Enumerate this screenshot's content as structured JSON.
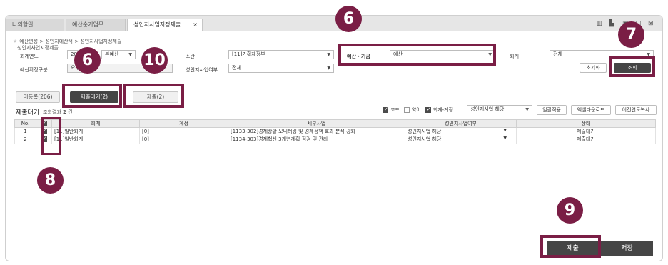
{
  "tabs": [
    {
      "label": "나의할일",
      "active": false
    },
    {
      "label": "예산순기업무",
      "active": false
    },
    {
      "label": "성인지사업지정제출",
      "active": true
    }
  ],
  "tab_close": "×",
  "breadcrumb": "예산편성 > 성인지예산서 > 성인지사업지정제출",
  "page_subtitle": "성인지사업지정제출",
  "filters": {
    "fiscal_year_label": "회계연도",
    "fiscal_year_value": "20",
    "budget_type_value": "본예산",
    "budget_confirm_label": "예산확정구분",
    "budget_confirm_value": "요구",
    "ministry_label": "소관",
    "ministry_value": "[11]기획재정부",
    "gender_business_label": "성인지사업여부",
    "gender_business_value": "전체",
    "budget_fund_label": "예산・기금",
    "budget_fund_value": "예산",
    "account_label": "회계",
    "account_value": "전체"
  },
  "buttons": {
    "reset": "초기화",
    "search": "조회",
    "apply_all": "일괄적용",
    "excel_download": "엑셀다운로드",
    "copy_prev_year": "이전연도복사",
    "submit": "제출",
    "save": "저장"
  },
  "subtabs": [
    {
      "label": "미등록(206)",
      "active": false
    },
    {
      "label": "제출대기(2)",
      "active": true
    },
    {
      "label": "제출(2)",
      "active": false
    }
  ],
  "section": {
    "title": "제출대기",
    "result_label": "조회결과",
    "result_count": "2",
    "result_unit": "건"
  },
  "options": {
    "code_label": "코드",
    "code_checked": true,
    "abbr_label": "약어",
    "abbr_checked": false,
    "account_item_label": "회계-계정",
    "account_item_checked": true,
    "bulk_select_value": "성인지사업 해당"
  },
  "grid": {
    "columns": [
      "No.",
      "",
      "회계",
      "계정",
      "세부사업",
      "성인지사업여부",
      "상태"
    ],
    "rows": [
      {
        "no": "1",
        "checked": true,
        "account": "[11]일반회계",
        "item": "[0]",
        "detail": "[1133-302]경제상황 모니터링 및 경제정책 효과 분석 강화",
        "gender": "성인지사업 해당",
        "status": "제출대기"
      },
      {
        "no": "2",
        "checked": true,
        "account": "[11]일반회계",
        "item": "[0]",
        "detail": "[1134-303]경제혁신 3개년계획 점검 및 관리",
        "gender": "성인지사업 해당",
        "status": "제출대기"
      }
    ]
  },
  "callouts": [
    "6",
    "6",
    "10",
    "7",
    "8",
    "9"
  ],
  "colors": {
    "callout": "#7a1e45",
    "dark_button": "#454545"
  }
}
